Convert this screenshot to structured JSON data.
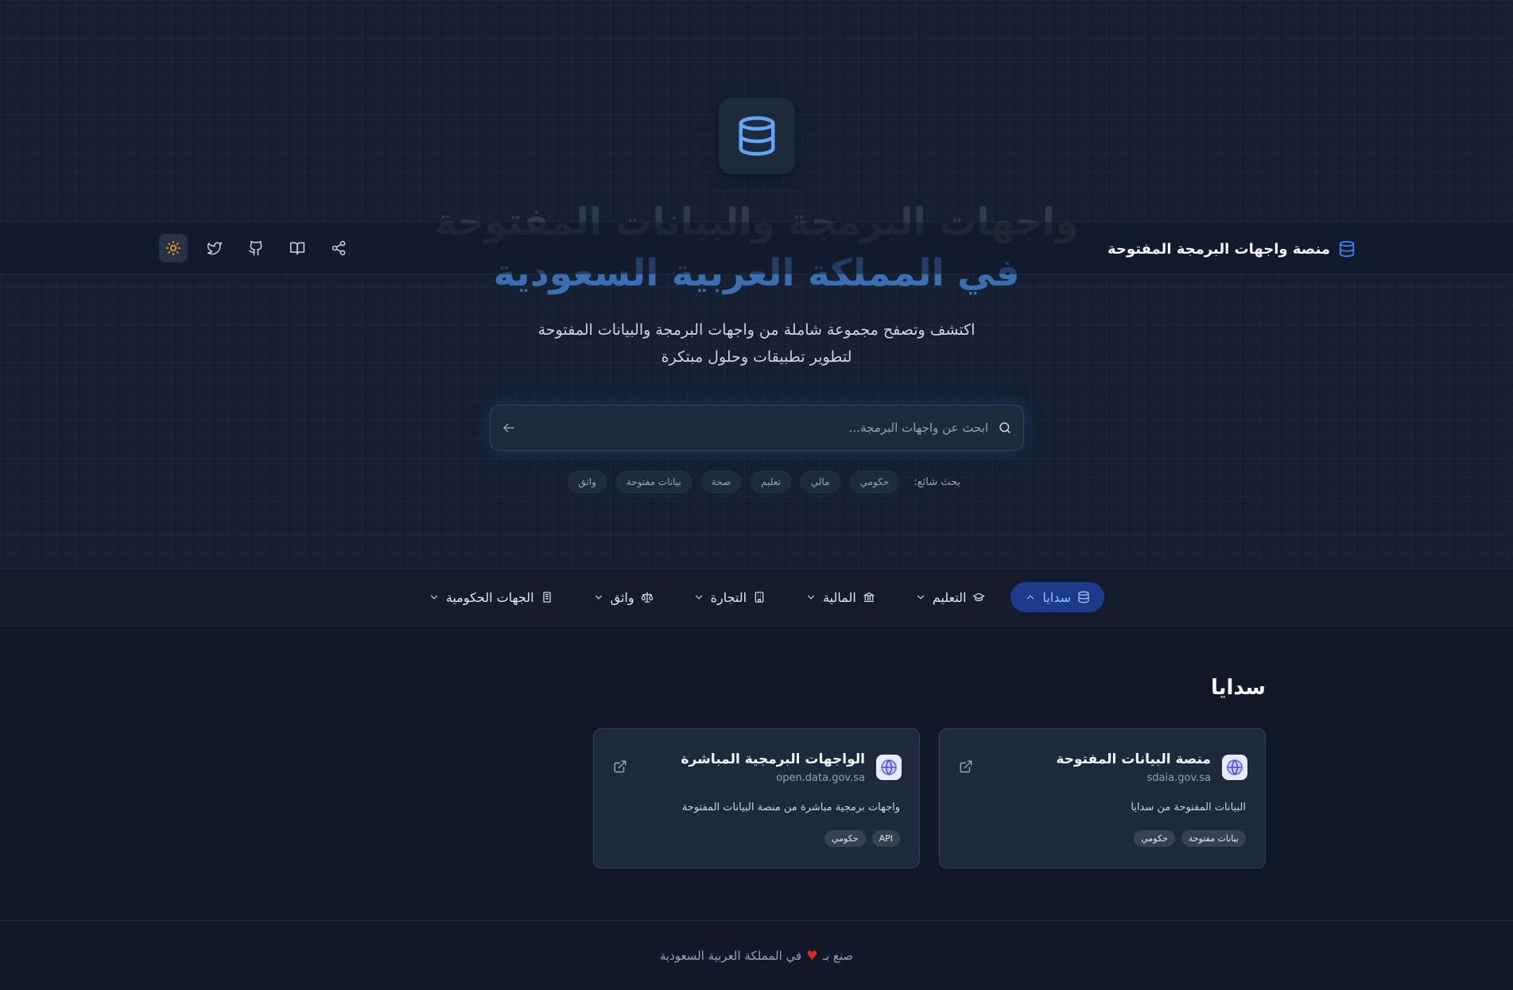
{
  "hero": {
    "title_line1": "واجهات البرمجة والبيانات المفتوحة",
    "title_line2": "في المملكة العربية السعودية",
    "subtitle_line1": "اكتشف وتصفح مجموعة شاملة من واجهات البرمجة والبيانات المفتوحة",
    "subtitle_line2": "لتطوير تطبيقات وحلول مبتكرة"
  },
  "navbar": {
    "brand": "منصة واجهات البرمجة المفتوحة",
    "actions": [
      "share-icon",
      "book-icon",
      "github-icon",
      "twitter-icon",
      "sun-icon"
    ]
  },
  "search": {
    "placeholder": "ابحث عن واجهات البرمجة...",
    "value": ""
  },
  "popular": {
    "label": "بحث شائع:",
    "chips": [
      "حكومي",
      "مالي",
      "تعليم",
      "صحة",
      "بيانات مفتوحة",
      "واثق"
    ]
  },
  "categories": [
    {
      "label": "سدايا",
      "icon": "database-icon",
      "active": true
    },
    {
      "label": "التعليم",
      "icon": "graduation-cap-icon",
      "active": false
    },
    {
      "label": "المالية",
      "icon": "bank-icon",
      "active": false
    },
    {
      "label": "التجارة",
      "icon": "building-icon",
      "active": false
    },
    {
      "label": "واثق",
      "icon": "scale-icon",
      "active": false
    },
    {
      "label": "الجهات الحكومية",
      "icon": "government-building-icon",
      "active": false
    }
  ],
  "section": {
    "title": "سدايا"
  },
  "cards": [
    {
      "title": "منصة البيانات المفتوحة",
      "domain": "sdaia.gov.sa",
      "description": "البيانات المفتوحة من سدايا",
      "tags": [
        "بيانات مفتوحة",
        "حكومي"
      ]
    },
    {
      "title": "الواجهات البرمجية المباشرة",
      "domain": "open.data.gov.sa",
      "description": "واجهات برمجية مباشرة من منصة البيانات المفتوحة",
      "tags": [
        "API",
        "حكومي"
      ]
    }
  ],
  "footer": {
    "made_with": "صنع بـ",
    "in_country": "في المملكة العربية السعودية"
  },
  "colors": {
    "background": "#111827",
    "accent": "#3b82f6",
    "active_category_bg": "#1e3a8a",
    "heart": "#dc2626",
    "sun": "#f59e0b"
  }
}
